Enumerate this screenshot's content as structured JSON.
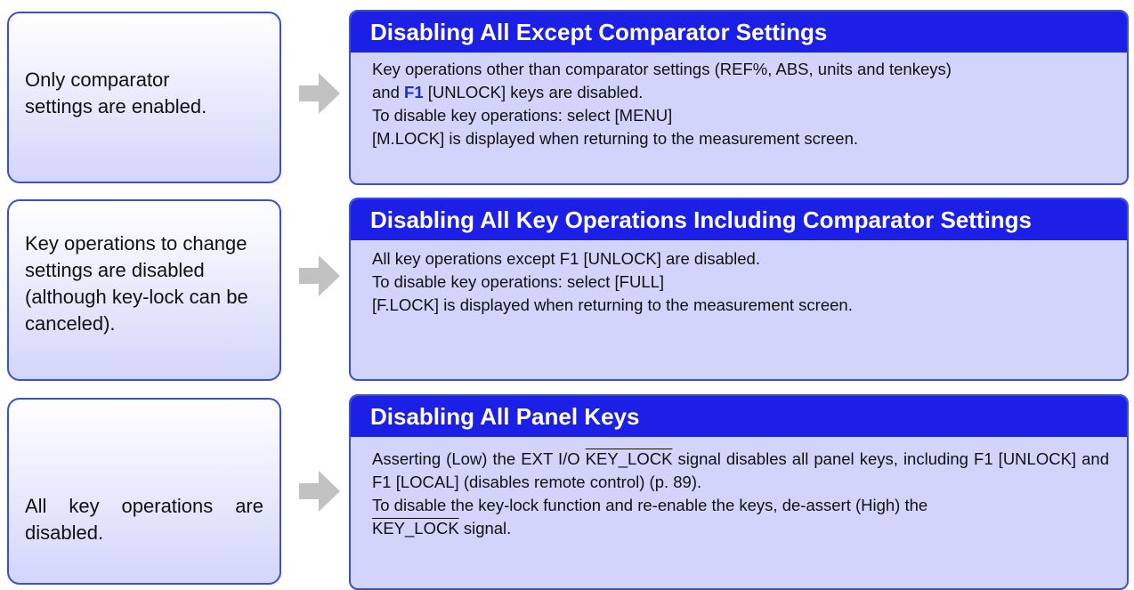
{
  "rows": [
    {
      "left_text": "Only comparator settings are enabled.",
      "title": "Disabling All Except Comparator Settings",
      "line1": "Key operations other than comparator settings (REF%, ABS, units and tenkeys)",
      "line2_pre": "and ",
      "line2_key": "F1",
      "line2_post": " [UNLOCK] keys are disabled.",
      "line3": "To disable key operations: select [MENU]",
      "line4": "[M.LOCK] is displayed when returning to the measurement screen."
    },
    {
      "left_text": "Key operations to change settings are disabled (although key-lock can be canceled).",
      "title": "Disabling All Key Operations Including Comparator Settings",
      "line1": "All key operations except F1 [UNLOCK] are disabled.",
      "line2": "To disable key operations: select [FULL]",
      "line3": "[F.LOCK] is displayed when returning to the measurement screen."
    },
    {
      "left_text": "All key operations are disabled.",
      "title": "Disabling All Panel Keys",
      "para1_pre": "Asserting (Low) the EXT I/O ",
      "para1_signal": "KEY_LOCK",
      "para1_post": " signal disables all panel keys, including F1 [UNLOCK] and F1 [LOCAL] (disables remote control) (p. 89).",
      "para2": "To disable the key-lock function and re-enable the keys, de-assert (High) the",
      "para3_signal": "KEY_LOCK",
      "para3_post": " signal."
    }
  ]
}
